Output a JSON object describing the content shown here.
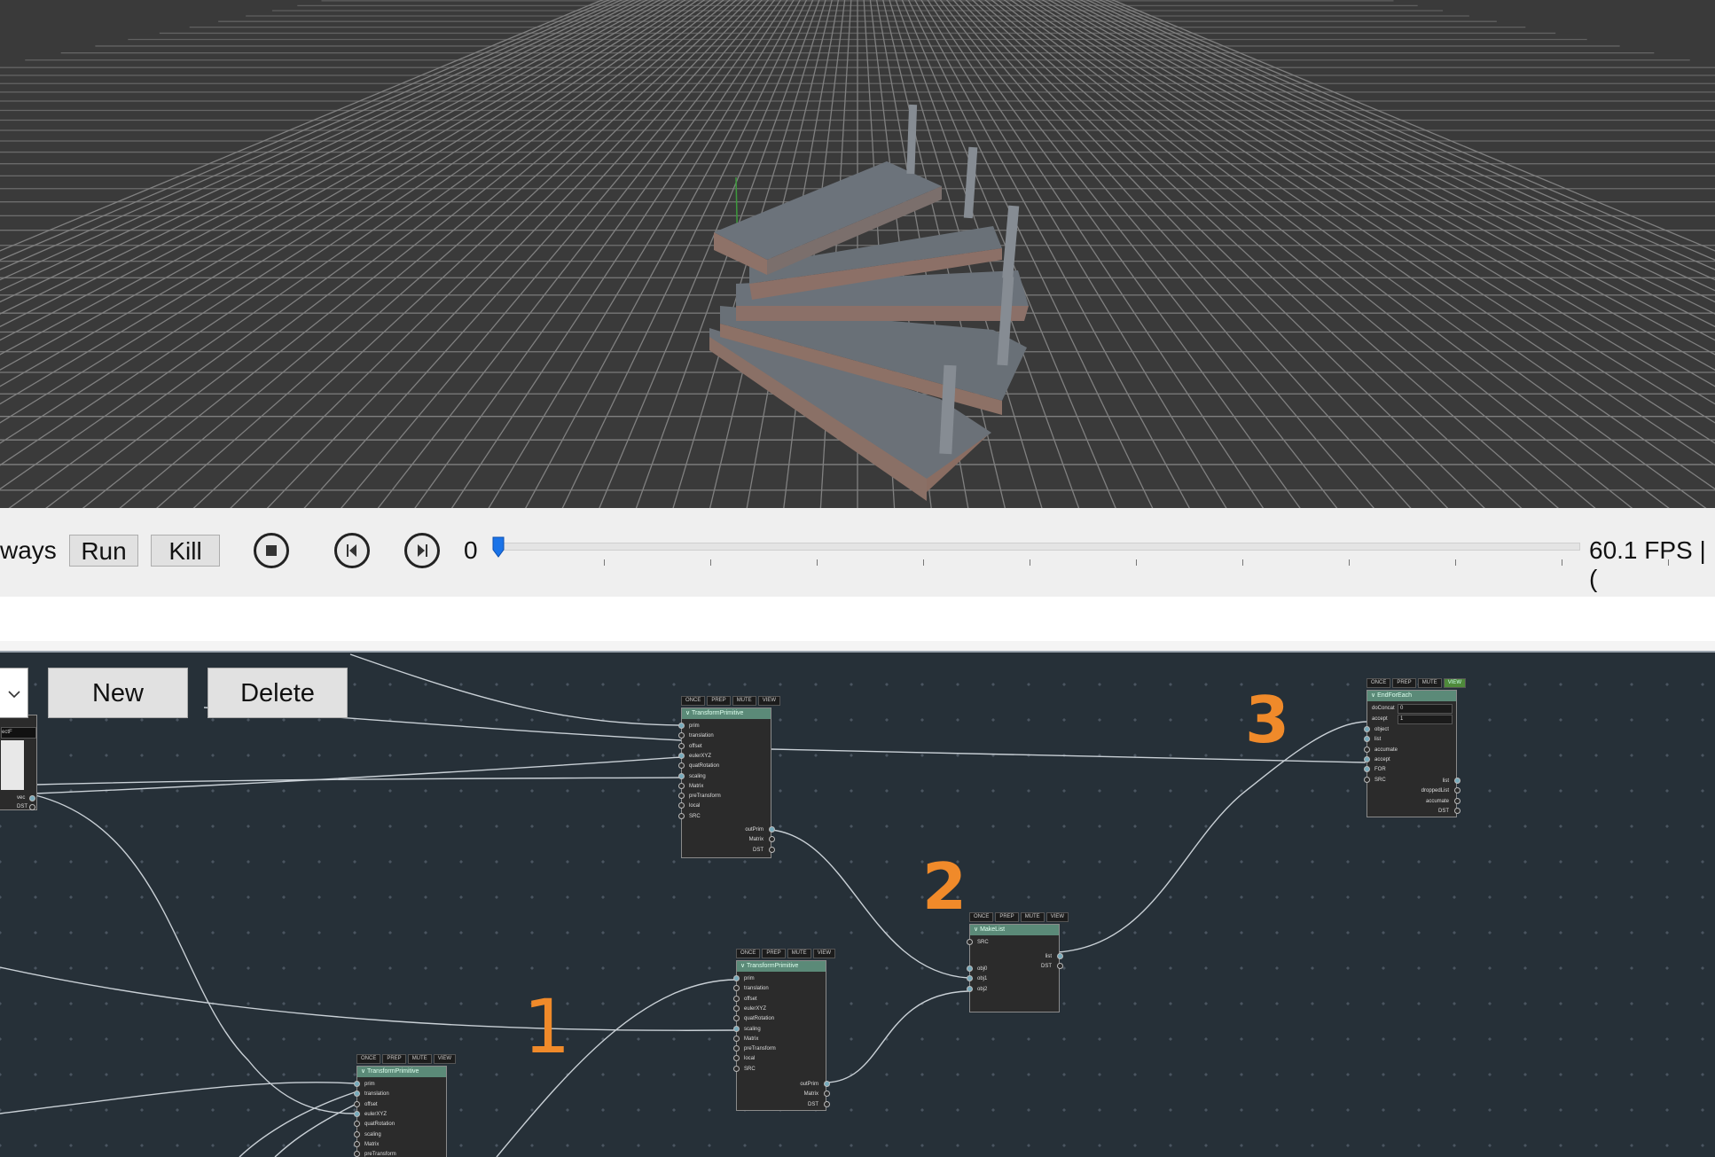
{
  "colors": {
    "viewport_bg": "#3a3a3a",
    "grid": "#8a8a8a",
    "graph_bg": "#263038",
    "node_header": "#5b8a78",
    "annotation": "#f08a2a",
    "slider": "#1a73e8"
  },
  "timeline": {
    "mode_label": "ways",
    "run_label": "Run",
    "kill_label": "Kill",
    "frame_value": "0",
    "fps_text": "60.1 FPS | (",
    "icons": [
      "stop-icon",
      "skip-back-icon",
      "skip-forward-icon"
    ]
  },
  "graph": {
    "new_label": "New",
    "delete_label": "Delete",
    "annotations": [
      "1",
      "2",
      "3"
    ],
    "tabs": [
      "ONCE",
      "PREP",
      "MUTE",
      "VIEW"
    ],
    "nodes": {
      "tp_top": {
        "title": "TransformPrimitive",
        "inputs": [
          "prim",
          "translation",
          "offset",
          "eulerXYZ",
          "quatRotation",
          "scaling",
          "Matrix",
          "preTransform",
          "local",
          "SRC"
        ],
        "outputs": [
          "outPrim",
          "Matrix",
          "DST"
        ]
      },
      "tp_mid": {
        "title": "TransformPrimitive",
        "inputs": [
          "prim",
          "translation",
          "offset",
          "eulerXYZ",
          "quatRotation",
          "scaling",
          "Matrix",
          "preTransform",
          "local",
          "SRC"
        ],
        "outputs": [
          "outPrim",
          "Matrix",
          "DST"
        ]
      },
      "tp_low": {
        "title": "TransformPrimitive",
        "inputs": [
          "prim",
          "translation",
          "offset",
          "eulerXYZ",
          "quatRotation",
          "scaling",
          "Matrix",
          "preTransform"
        ]
      },
      "makelist": {
        "title": "MakeList",
        "inputs_top": [
          "SRC"
        ],
        "inputs": [
          "obj0",
          "obj1",
          "obj2"
        ],
        "outputs": [
          "list",
          "DST"
        ]
      },
      "endforeach": {
        "title": "EndForEach",
        "fields": [
          [
            "doConcat",
            "0"
          ],
          [
            "accept",
            "1"
          ]
        ],
        "inputs": [
          "object",
          "list",
          "accumate",
          "accept",
          "FOR",
          "SRC"
        ],
        "outputs": [
          "list",
          "droppedList",
          "accumate",
          "DST"
        ]
      },
      "left_partial": {
        "field": "ectF",
        "outputs": [
          "vec",
          "DST"
        ]
      }
    }
  }
}
